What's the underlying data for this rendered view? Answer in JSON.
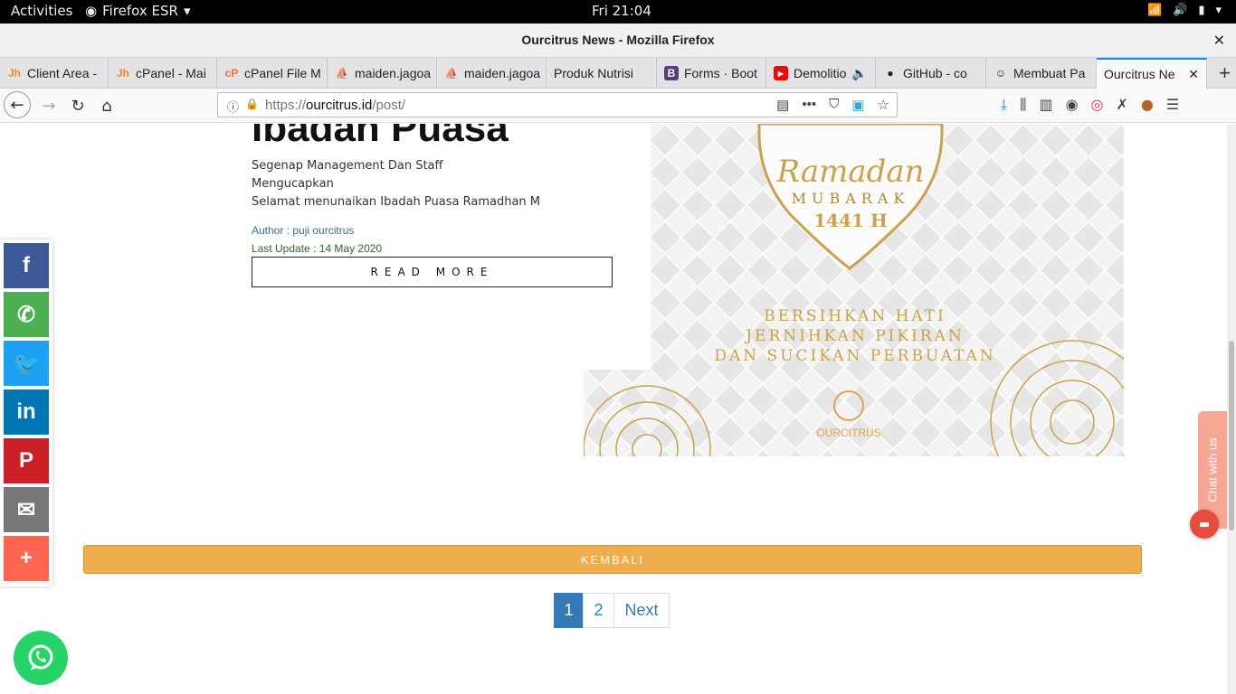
{
  "topbar": {
    "activities": "Activities",
    "app": "Firefox ESR",
    "clock": "Fri 21:04"
  },
  "window": {
    "title": "Ourcitrus News - Mozilla Firefox"
  },
  "tabs": [
    {
      "label": "Client Area -"
    },
    {
      "label": "cPanel - Mai"
    },
    {
      "label": "cPanel File M"
    },
    {
      "label": "maiden.jagoa"
    },
    {
      "label": "maiden.jagoa"
    },
    {
      "label": "Produk Nutrisi"
    },
    {
      "label": "Forms · Boot"
    },
    {
      "label": "Demolitio"
    },
    {
      "label": "GitHub - co"
    },
    {
      "label": "Membuat Pa"
    },
    {
      "label": "Ourcitrus Ne"
    }
  ],
  "urlbar": {
    "prefix": "https://",
    "domain": "ourcitrus.id",
    "path": "/post/"
  },
  "post": {
    "title": "Ibadan Puasa",
    "excerpt": [
      "Segenap Management Dan Staff",
      "Mengucapkan",
      "Selamat menunaikan Ibadah Puasa Ramadhan M"
    ],
    "author": "Author : puji ourcitrus",
    "updated": "Last Update : 14 May 2020",
    "read_more": "READ MORE"
  },
  "banner": {
    "script": "Ramadan",
    "mubarak": "MUBARAK",
    "year": "1441 H",
    "line1": "BERSIHKAN HATI",
    "line2": "JERNIHKAN PIKIRAN",
    "line3": "DAN SUCIKAN PERBUATAN",
    "brand": "OURCITRUS"
  },
  "kembali": "KEMBALI",
  "pagination": {
    "p1": "1",
    "p2": "2",
    "next": "Next"
  },
  "chat": {
    "label": "Chat with us"
  },
  "colors": {
    "accent": "#f0ad4e",
    "link": "#337ab7",
    "gold": "#c9a24a"
  }
}
